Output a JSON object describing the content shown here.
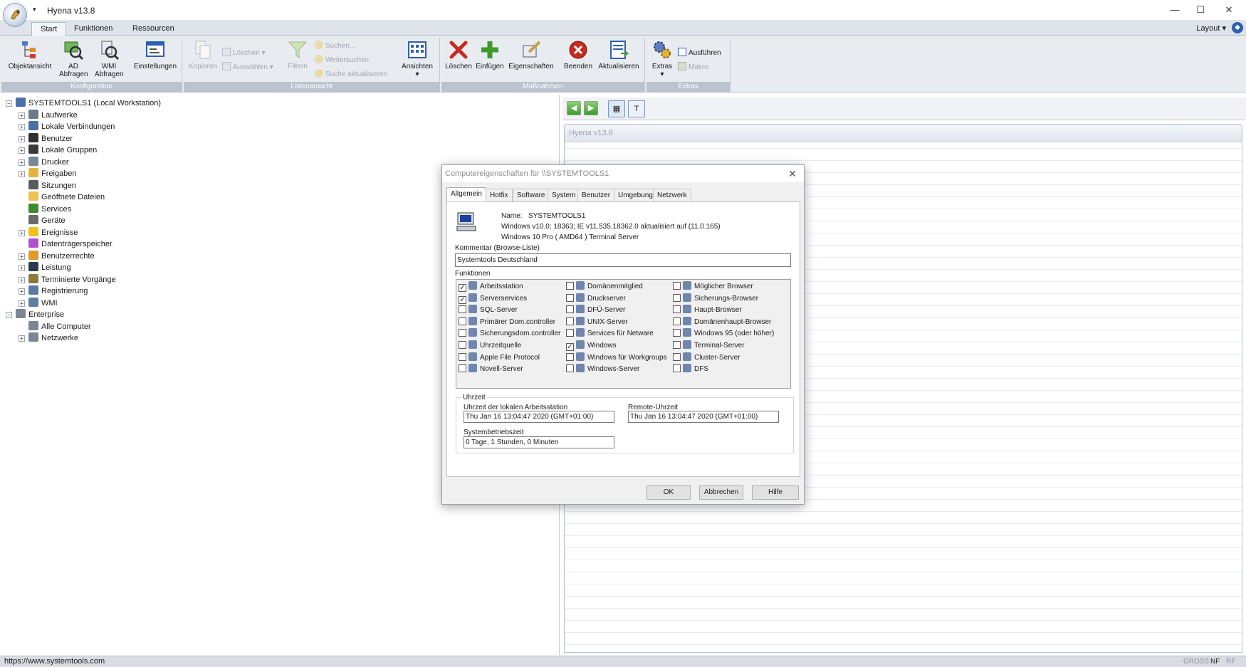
{
  "window": {
    "title": "Hyena v13.8",
    "qat_arrow": "▾",
    "minimize": "—",
    "maximize": "☐",
    "close": "✕"
  },
  "ribbon": {
    "tabs": [
      {
        "label": "Start",
        "active": true
      },
      {
        "label": "Funktionen",
        "active": false
      },
      {
        "label": "Ressourcen",
        "active": false
      }
    ],
    "layout_label": "Layout",
    "layout_arrow": "▾",
    "help_glyph": "◆",
    "groups": {
      "konfiguration": {
        "label": "Konfiguration",
        "buttons": [
          "Objektansicht",
          "AD Abfragen",
          "WMI Abfragen",
          "Einstellungen"
        ]
      },
      "listenansicht": {
        "label": "Listenansicht",
        "kopieren": "Kopieren",
        "loeschen": "Löschen ▾",
        "auswaehlen": "Auswählen ▾",
        "filtern": "Filtern",
        "suchen": "Suchen...",
        "weitersuchen": "Weitersuchen",
        "suche_aktualisieren": "Suche aktualisieren",
        "ansichten": "Ansichten",
        "ansichten_arrow": "▾"
      },
      "massnahmen": {
        "label": "Maßnahmen",
        "buttons": [
          "Löschen",
          "Einfügen",
          "Eigenschaften",
          "Beenden",
          "Aktualisieren"
        ]
      },
      "extras": {
        "label": "Extras",
        "extras_button": "Extras",
        "extras_arrow": "▾",
        "ausfuehren": "Ausführen",
        "makro": "Makro"
      }
    }
  },
  "tree": {
    "expander": "+",
    "root": "SYSTEMTOOLS1 (Local Workstation)",
    "items": [
      {
        "label": "Laufwerke",
        "expandable": true,
        "icon": "drive-icon",
        "color": "#6d7a8a"
      },
      {
        "label": "Lokale Verbindungen",
        "expandable": true,
        "icon": "network-connection-icon",
        "color": "#4b6fa8"
      },
      {
        "label": "Benutzer",
        "expandable": true,
        "icon": "user-icon",
        "color": "#2f2f2f"
      },
      {
        "label": "Lokale Gruppen",
        "expandable": true,
        "icon": "group-icon",
        "color": "#3a3a3a"
      },
      {
        "label": "Drucker",
        "expandable": true,
        "icon": "printer-icon",
        "color": "#7b8794"
      },
      {
        "label": "Freigaben",
        "expandable": true,
        "icon": "shared-folder-icon",
        "color": "#e4b43c"
      },
      {
        "label": "Sitzungen",
        "expandable": false,
        "icon": "session-icon",
        "color": "#5a5a5a"
      },
      {
        "label": "Geöffnete Dateien",
        "expandable": false,
        "icon": "open-folder-icon",
        "color": "#f0c24f"
      },
      {
        "label": "Services",
        "expandable": false,
        "icon": "services-gear-icon",
        "color": "#3e8a2e"
      },
      {
        "label": "Geräte",
        "expandable": false,
        "icon": "devices-icon",
        "color": "#6a6a6a"
      },
      {
        "label": "Ereignisse",
        "expandable": true,
        "icon": "warning-icon",
        "color": "#f2c21b"
      },
      {
        "label": "Datenträgerspeicher",
        "expandable": false,
        "icon": "disk-quota-icon",
        "color": "#b44fd0"
      },
      {
        "label": "Benutzerrechte",
        "expandable": true,
        "icon": "rights-icon",
        "color": "#e09a2a"
      },
      {
        "label": "Leistung",
        "expandable": true,
        "icon": "performance-icon",
        "color": "#2b3a4a"
      },
      {
        "label": "Terminierte Vorgänge",
        "expandable": true,
        "icon": "scheduled-task-icon",
        "color": "#8c7a3a"
      },
      {
        "label": "Registrierung",
        "expandable": true,
        "icon": "registry-icon",
        "color": "#5b7aa8"
      },
      {
        "label": "WMI",
        "expandable": true,
        "icon": "wmi-icon",
        "color": "#5f7fa0"
      }
    ],
    "enterprise": "Enterprise",
    "enterprise_items": [
      {
        "label": "Alle Computer",
        "expandable": false,
        "icon": "all-computers-icon",
        "color": "#7a8696"
      },
      {
        "label": "Netzwerke",
        "expandable": true,
        "icon": "network-icon",
        "color": "#7a8696"
      }
    ]
  },
  "right_pane": {
    "back": "◀",
    "forward": "▶",
    "view_grid": "▦",
    "view_text": "T",
    "panel_title": "Hyena v13.8"
  },
  "status_bar": {
    "url": "https://www.systemtools.com",
    "caps": "GROSS",
    "num": "NF",
    "scroll": "RF"
  },
  "dialog": {
    "title": "Computereigenschaften für \\\\SYSTEMTOOLS1",
    "close": "✕",
    "tabs": [
      {
        "label": "Allgemein",
        "active": true
      },
      {
        "label": "Hotfix",
        "active": false
      },
      {
        "label": "Software",
        "active": false
      },
      {
        "label": "System",
        "active": false
      },
      {
        "label": "Benutzer",
        "active": false
      },
      {
        "label": "Umgebung",
        "active": false
      },
      {
        "label": "Netzwerk",
        "active": false
      }
    ],
    "name_label": "Name:",
    "name_value": "SYSTEMTOOLS1",
    "os_line1": "Windows v10.0; 18363; IE v11.535.18362.0 aktualisiert auf (11.0.165)",
    "os_line2": "Windows 10 Pro ( AMD64 ) Terminal Server",
    "comment_label": "Kommentar (Browse-Liste)",
    "comment_value": "Systemtools Deutschland",
    "functions_label": "Funktionen",
    "check_mark": "✓",
    "functions": [
      [
        {
          "label": "Arbeitsstation",
          "checked": true
        },
        {
          "label": "Serverservices",
          "checked": true
        },
        {
          "label": "SQL-Server",
          "checked": false
        },
        {
          "label": "Primärer Dom.controller",
          "checked": false
        },
        {
          "label": "Sicherungsdom.controller",
          "checked": false
        },
        {
          "label": "Uhrzeitquelle",
          "checked": false
        },
        {
          "label": "Apple File Protocol",
          "checked": false
        },
        {
          "label": "Novell-Server",
          "checked": false
        }
      ],
      [
        {
          "label": "Domänenmitglied",
          "checked": false
        },
        {
          "label": "Druckserver",
          "checked": false
        },
        {
          "label": "DFÜ-Server",
          "checked": false
        },
        {
          "label": "UNIX-Server",
          "checked": false
        },
        {
          "label": "Services für Netware",
          "checked": false
        },
        {
          "label": "Windows",
          "checked": true
        },
        {
          "label": "Windows für Workgroups",
          "checked": false
        },
        {
          "label": "Windows-Server",
          "checked": false
        }
      ],
      [
        {
          "label": "Möglicher Browser",
          "checked": false
        },
        {
          "label": "Sicherungs-Browser",
          "checked": false
        },
        {
          "label": "Haupt-Browser",
          "checked": false
        },
        {
          "label": "Domänenhaupt-Browser",
          "checked": false
        },
        {
          "label": "Windows 95 (oder höher)",
          "checked": false
        },
        {
          "label": "Terminal-Server",
          "checked": false
        },
        {
          "label": "Cluster-Server",
          "checked": false
        },
        {
          "label": "DFS",
          "checked": false
        }
      ]
    ],
    "time_group_label": "Uhrzeit",
    "local_time_label": "Uhrzeit der lokalen Arbeitsstation",
    "local_time_value": "Thu Jan 16 13:04:47 2020  (GMT+01:00)",
    "remote_time_label": "Remote-Uhrzeit",
    "remote_time_value": "Thu Jan 16 13:04:47 2020  (GMT+01:00)",
    "uptime_label": "Systembetriebszeit",
    "uptime_value": "0 Tage, 1 Stunden, 0 Minuten",
    "ok": "OK",
    "cancel": "Abbrechen",
    "help": "Hilfe"
  }
}
